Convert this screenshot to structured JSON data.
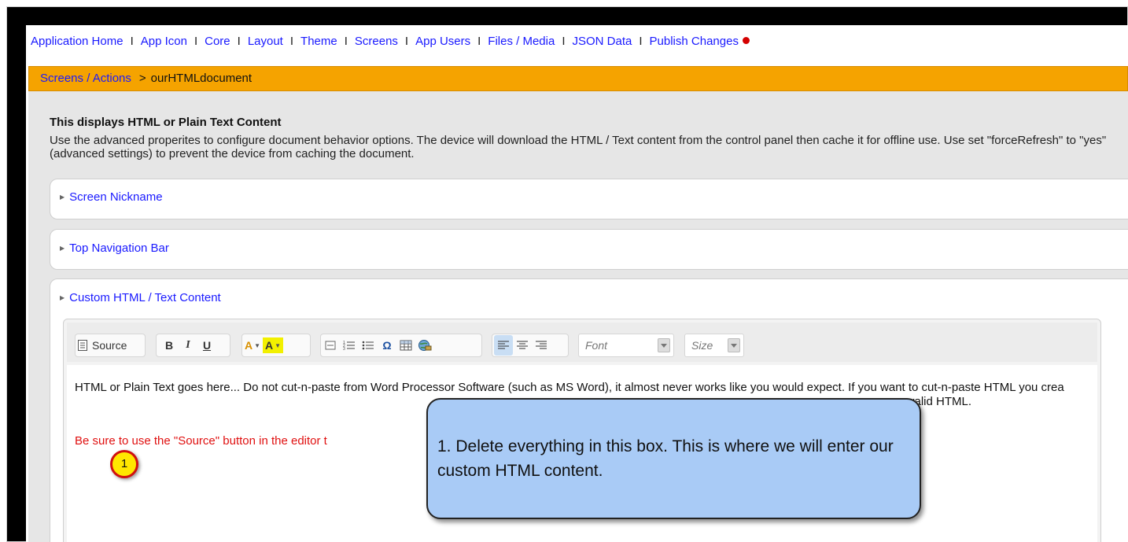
{
  "top_nav": {
    "items": [
      "Application Home",
      "App Icon",
      "Core",
      "Layout",
      "Theme",
      "Screens",
      "App Users",
      "Files / Media",
      "JSON Data",
      "Publish Changes"
    ],
    "separator": "I"
  },
  "breadcrumb": {
    "link": "Screens / Actions",
    "separator": ">",
    "current": "ourHTMLdocument"
  },
  "main": {
    "heading": "This displays HTML or Plain Text Content",
    "description": "Use the advanced properites to configure document behavior options. The device will download the HTML / Text content from the control panel then cache it for offline use. Use set \"forceRefresh\" to \"yes\" (advanced settings) to prevent the device from caching the document.",
    "sections": [
      "Screen Nickname",
      "Top Navigation Bar",
      "Custom HTML / Text Content"
    ]
  },
  "editor": {
    "source_label": "Source",
    "bold": "B",
    "italic": "I",
    "underline": "U",
    "text_color": "A",
    "bg_color": "A",
    "font_placeholder": "Font",
    "size_placeholder": "Size",
    "body_text": "HTML or Plain Text goes here... Do not cut-n-paste from Word Processor Software (such as MS Word), it almost never works like you would expect. If you want to cut-n-paste HTML you crea",
    "body_text_tail": "valid HTML.",
    "red_text": "Be sure to use the \"Source\" button in the editor t"
  },
  "annotation": {
    "number": "1",
    "text": "1.  Delete everything in this box.  This is where we will enter our custom HTML content."
  },
  "colors": {
    "link": "#1a1aff",
    "orange_bar": "#f5a300",
    "panel": "#e6e6e6",
    "callout_fill": "#a9cbf6",
    "marker": "#ffe700",
    "red_text": "#e01010",
    "publish_dot": "#d40000"
  }
}
